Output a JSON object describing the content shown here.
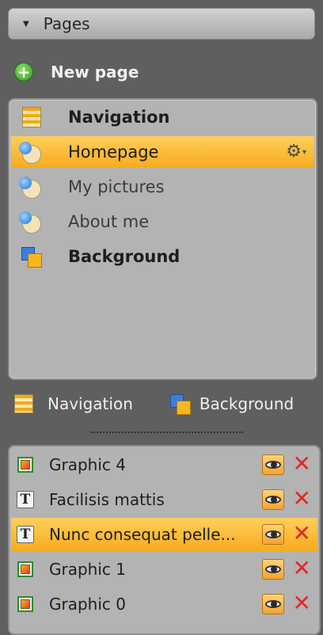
{
  "header": {
    "title": "Pages",
    "arrow": "▼"
  },
  "new_page": {
    "label": "New page",
    "icon_glyph": "+"
  },
  "pages": [
    {
      "label": "Navigation",
      "icon": "navigation-icon",
      "bold": true,
      "selected": false
    },
    {
      "label": "Homepage",
      "icon": "page-icon",
      "bold": false,
      "selected": true
    },
    {
      "label": "My pictures",
      "icon": "page-icon",
      "bold": false,
      "selected": false
    },
    {
      "label": "About me",
      "icon": "page-icon",
      "bold": false,
      "selected": false
    },
    {
      "label": "Background",
      "icon": "background-icon",
      "bold": true,
      "selected": false
    }
  ],
  "page_settings": {
    "gear": "⚙",
    "caret": "▾"
  },
  "tools": {
    "navigation_label": "Navigation",
    "background_label": "Background"
  },
  "layers": [
    {
      "label": "Graphic 4",
      "type": "graphic",
      "selected": false
    },
    {
      "label": "Facilisis mattis",
      "type": "text",
      "selected": false
    },
    {
      "label": "Nunc consequat pelle...",
      "type": "text",
      "selected": true
    },
    {
      "label": "Graphic 1",
      "type": "graphic",
      "selected": false
    },
    {
      "label": "Graphic 0",
      "type": "graphic",
      "selected": false
    }
  ],
  "layer_icons": {
    "text_glyph": "T",
    "delete_glyph": "✕"
  },
  "colors": {
    "selection": "#f9b529",
    "panel": "#b3b3b3",
    "background": "#5f5f5f",
    "delete": "#e02a2a"
  }
}
